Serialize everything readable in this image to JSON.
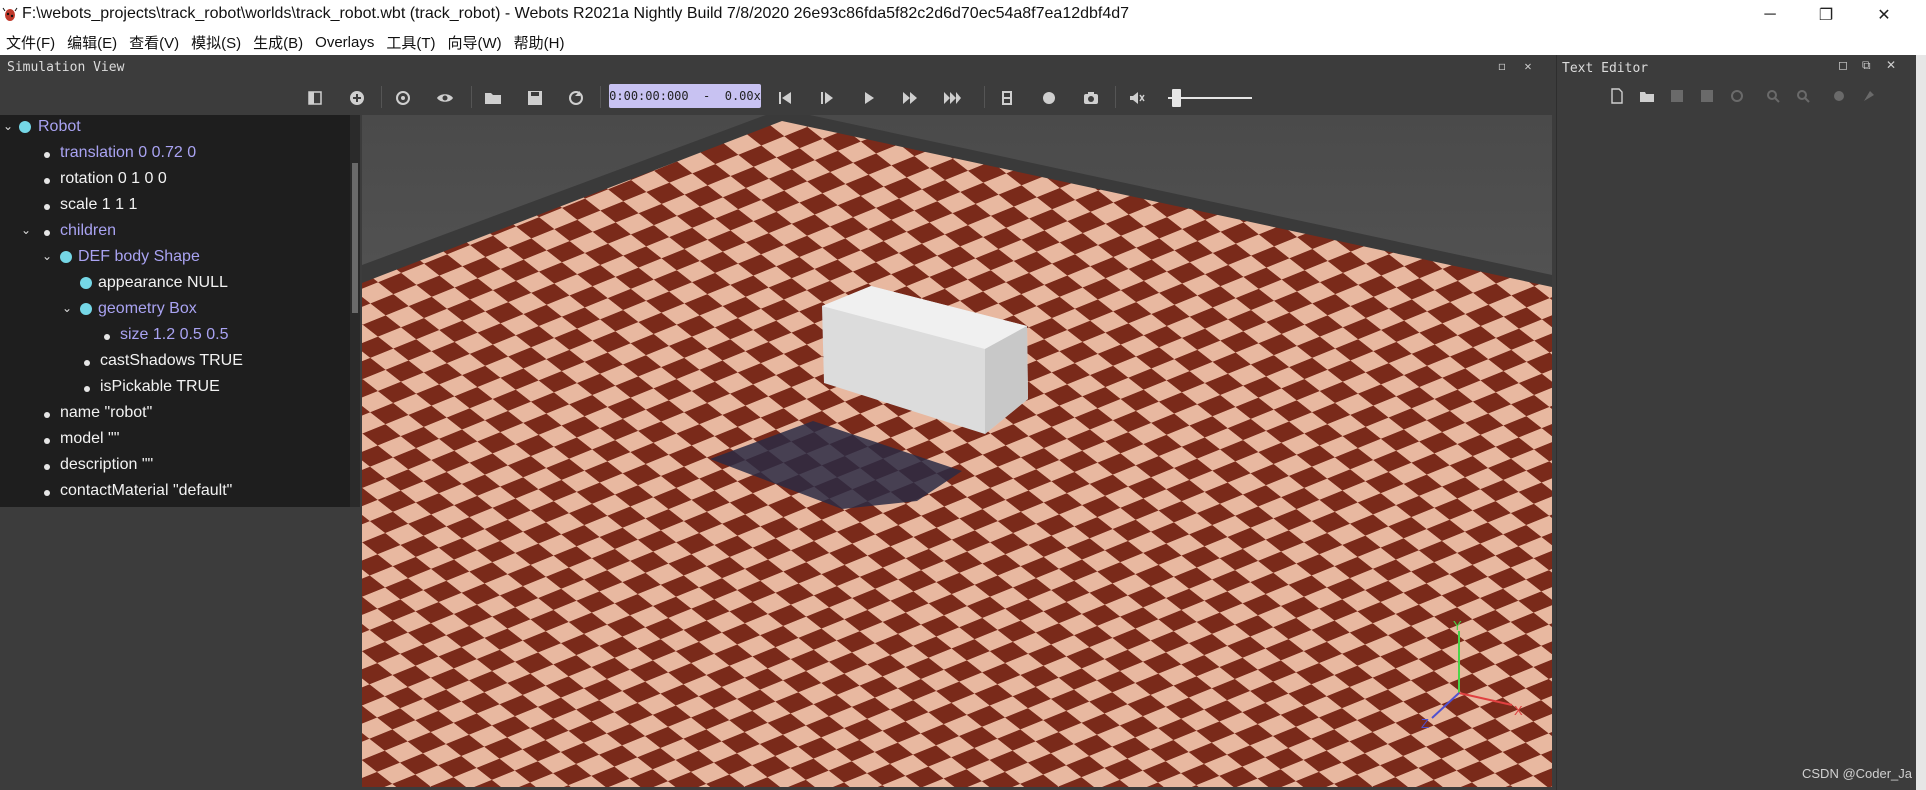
{
  "window": {
    "title": "F:\\webots_projects\\track_robot\\worlds\\track_robot.wbt (track_robot) - Webots R2021a Nightly Build 7/8/2020 26e93c86fda5f82c2d6d70ec54a8f7ea12dbf4d7",
    "minimize": "─",
    "restore": "❐",
    "close": "✕"
  },
  "menu": [
    "文件(F)",
    "编辑(E)",
    "查看(V)",
    "模拟(S)",
    "生成(B)",
    "Overlays",
    "工具(T)",
    "向导(W)",
    "帮助(H)"
  ],
  "simulation_view": {
    "title": "Simulation View",
    "time": "0:00:00:000  -  0.00x",
    "speed_slider": 0.05
  },
  "text_editor": {
    "title": "Text Editor"
  },
  "scene_tree": {
    "robot": "Robot",
    "translation": "translation 0 0.72 0",
    "rotation": "rotation 0 1 0 0",
    "scale": "scale 1 1 1",
    "children": "children",
    "def_body": "DEF body Shape",
    "appearance": "appearance NULL",
    "geometry": "geometry Box",
    "size": "size 1.2 0.5 0.5",
    "cast_shadows": "castShadows TRUE",
    "is_pickable": "isPickable TRUE",
    "name": "name \"robot\"",
    "model": "model \"\"",
    "description": "description \"\"",
    "contact_material": "contactMaterial \"default\""
  },
  "axes": {
    "x": "X",
    "y": "Y",
    "z": "Z"
  },
  "watermark": "CSDN @Coder_Ja",
  "colors": {
    "tree_blue": "#a9a3f2",
    "time_box": "#c8c2f2",
    "tile_dark": "#7a2a1a",
    "tile_light": "#e8b8a0"
  }
}
